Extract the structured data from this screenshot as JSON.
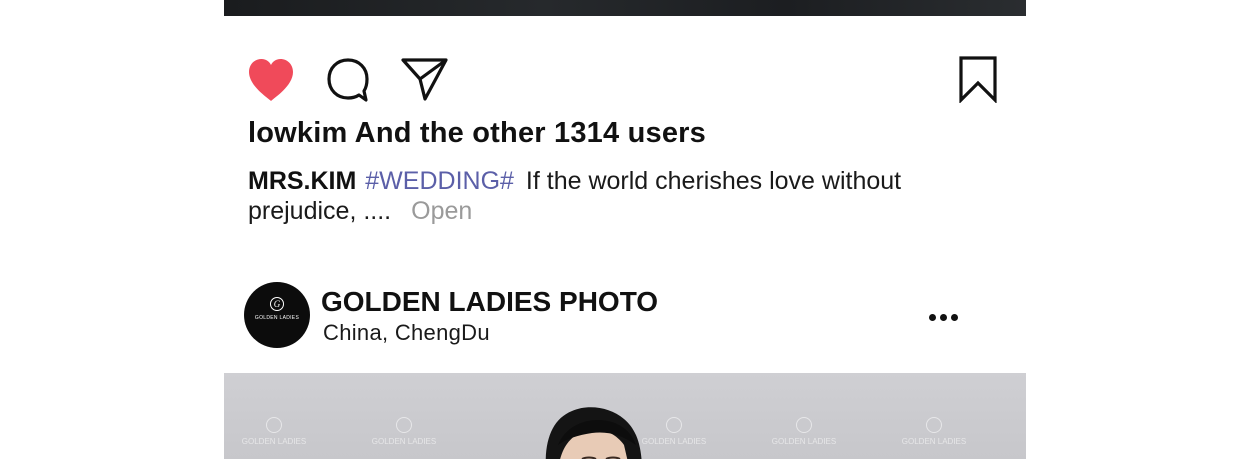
{
  "actions": {
    "like_icon": "heart-filled-icon",
    "comment_icon": "comment-bubble-icon",
    "share_icon": "paper-plane-icon",
    "bookmark_icon": "bookmark-icon",
    "like_color": "#f04a5a"
  },
  "likes_text": "lowkim And the other 1314 users",
  "caption": {
    "author": "MRS.KIM",
    "hashtag": "#WEDDING#",
    "text": "If the world cherishes love without prejudice, ....",
    "open_label": "Open"
  },
  "post": {
    "avatar_brand": "GOLDEN LADIES",
    "account_name": "GOLDEN LADIES PHOTO",
    "location_country": "China,",
    "location_city": "ChengDu",
    "more_icon": "more-horizontal-icon",
    "watermark_text": "GOLDEN LADIES"
  },
  "colors": {
    "hashtag": "#5b5fa8",
    "open": "#9a9a9a",
    "text": "#111111"
  }
}
